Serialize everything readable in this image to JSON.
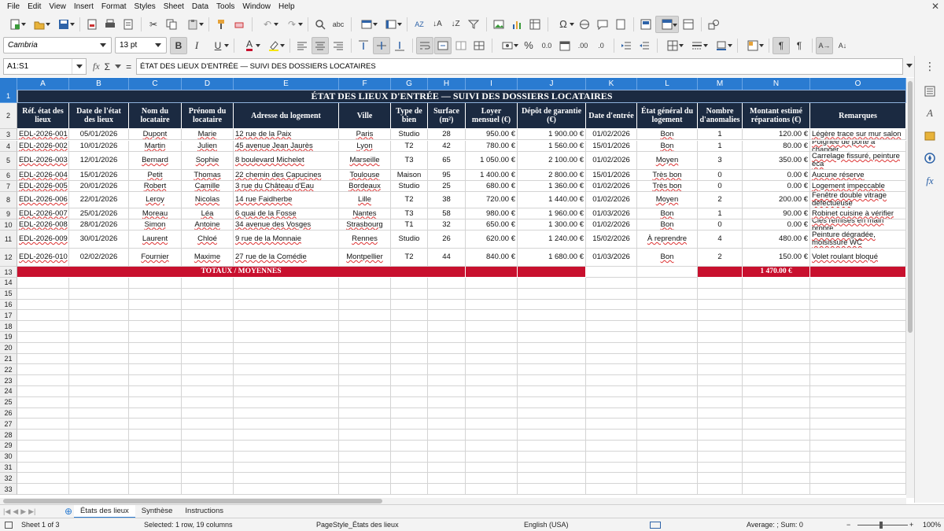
{
  "menu": [
    "File",
    "Edit",
    "View",
    "Insert",
    "Format",
    "Styles",
    "Sheet",
    "Data",
    "Tools",
    "Window",
    "Help"
  ],
  "toolbar": {
    "font_name": "Cambria",
    "font_size": "13 pt",
    "bold": "B",
    "italic": "I",
    "underline": "U",
    "font_color_letter": "A",
    "percent": "%",
    "decimal": "0.0",
    "add_decimal": ".00",
    "remove_decimal": ".0"
  },
  "formula": {
    "name_box": "A1:S1",
    "fx": "fx",
    "sigma": "Σ",
    "equals": "=",
    "content": "ÉTAT DES LIEUX D'ENTRÉE — SUIVI DES DOSSIERS LOCATAIRES"
  },
  "columns": [
    "A",
    "B",
    "C",
    "D",
    "E",
    "F",
    "G",
    "H",
    "I",
    "J",
    "K",
    "L",
    "M",
    "N",
    "O"
  ],
  "row_numbers": [
    "1",
    "2",
    "3",
    "4",
    "5",
    "6",
    "7",
    "8",
    "9",
    "10",
    "11",
    "12",
    "13",
    "14",
    "15",
    "16",
    "17",
    "18",
    "19",
    "20",
    "21",
    "22",
    "23",
    "24",
    "25",
    "26",
    "27",
    "28",
    "29",
    "30",
    "31",
    "32",
    "33"
  ],
  "sheet": {
    "title": "ÉTAT DES LIEUX D'ENTRÉE — SUIVI DES DOSSIERS LOCATAIRES",
    "headers": [
      "Réf. état des lieux",
      "Date de l'état des lieux",
      "Nom du locataire",
      "Prénom du locataire",
      "Adresse du logement",
      "Ville",
      "Type de bien",
      "Surface (m²)",
      "Loyer mensuel (€)",
      "Dépôt de garantie (€)",
      "Date d'entrée",
      "État général du logement",
      "Nombre d'anomalies",
      "Montant estimé réparations (€)",
      "Remarques"
    ],
    "rows": [
      [
        "EDL-2026-001",
        "05/01/2026",
        "Dupont",
        "Marie",
        "12 rue de la Paix",
        "Paris",
        "Studio",
        "28",
        "950.00 €",
        "1 900.00 €",
        "01/02/2026",
        "Bon",
        "1",
        "120.00 €",
        "Légère trace sur mur salon"
      ],
      [
        "EDL-2026-002",
        "10/01/2026",
        "Martin",
        "Julien",
        "45 avenue Jean Jaurès",
        "Lyon",
        "T2",
        "42",
        "780.00 €",
        "1 560.00 €",
        "15/01/2026",
        "Bon",
        "1",
        "80.00 €",
        "Poignée de porte à changer"
      ],
      [
        "EDL-2026-003",
        "12/01/2026",
        "Bernard",
        "Sophie",
        "8 boulevard Michelet",
        "Marseille",
        "T3",
        "65",
        "1 050.00 €",
        "2 100.00 €",
        "01/02/2026",
        "Moyen",
        "3",
        "350.00 €",
        "Carrelage fissuré, peinture éca"
      ],
      [
        "EDL-2026-004",
        "15/01/2026",
        "Petit",
        "Thomas",
        "22 chemin des Capucines",
        "Toulouse",
        "Maison",
        "95",
        "1 400.00 €",
        "2 800.00 €",
        "15/01/2026",
        "Très bon",
        "0",
        "0.00 €",
        "Aucune réserve"
      ],
      [
        "EDL-2026-005",
        "20/01/2026",
        "Robert",
        "Camille",
        "3 rue du Château d'Eau",
        "Bordeaux",
        "Studio",
        "25",
        "680.00 €",
        "1 360.00 €",
        "01/02/2026",
        "Très bon",
        "0",
        "0.00 €",
        "Logement impeccable"
      ],
      [
        "EDL-2026-006",
        "22/01/2026",
        "Leroy",
        "Nicolas",
        "14 rue Faidherbe",
        "Lille",
        "T2",
        "38",
        "720.00 €",
        "1 440.00 €",
        "01/02/2026",
        "Moyen",
        "2",
        "200.00 €",
        "Fenêtre double vitrage défectueuse"
      ],
      [
        "EDL-2026-007",
        "25/01/2026",
        "Moreau",
        "Léa",
        "6 quai de la Fosse",
        "Nantes",
        "T3",
        "58",
        "980.00 €",
        "1 960.00 €",
        "01/03/2026",
        "Bon",
        "1",
        "90.00 €",
        "Robinet cuisine à vérifier"
      ],
      [
        "EDL-2026-008",
        "28/01/2026",
        "Simon",
        "Antoine",
        "34 avenue des Vosges",
        "Strasbourg",
        "T1",
        "32",
        "650.00 €",
        "1 300.00 €",
        "01/02/2026",
        "Bon",
        "0",
        "0.00 €",
        "Clés remises en main propre"
      ],
      [
        "EDL-2026-009",
        "30/01/2026",
        "Laurent",
        "Chloé",
        "9 rue de la Monnaie",
        "Rennes",
        "Studio",
        "26",
        "620.00 €",
        "1 240.00 €",
        "15/02/2026",
        "À reprendre",
        "4",
        "480.00 €",
        "Peinture dégradée, moisissure WC"
      ],
      [
        "EDL-2026-010",
        "02/02/2026",
        "Fournier",
        "Maxime",
        "27 rue de la Comédie",
        "Montpellier",
        "T2",
        "44",
        "840.00 €",
        "1 680.00 €",
        "01/03/2026",
        "Bon",
        "2",
        "150.00 €",
        "Volet roulant bloqué"
      ]
    ],
    "totals_label": "TOTAUX / MOYENNES",
    "totals_amount": "1 470.00 €"
  },
  "tabs": [
    "États des lieux",
    "Synthèse",
    "Instructions"
  ],
  "status": {
    "sheet": "Sheet 1 of 3",
    "selection": "Selected: 1 row, 19 columns",
    "page_style": "PageStyle_États des lieux",
    "language": "English (USA)",
    "summary": "Average: ; Sum: 0",
    "zoom": "100%"
  },
  "colors": {
    "header_bg": "#1b2a41",
    "totals_bg": "#c8102e",
    "selection_blue": "#2a7bd1"
  }
}
